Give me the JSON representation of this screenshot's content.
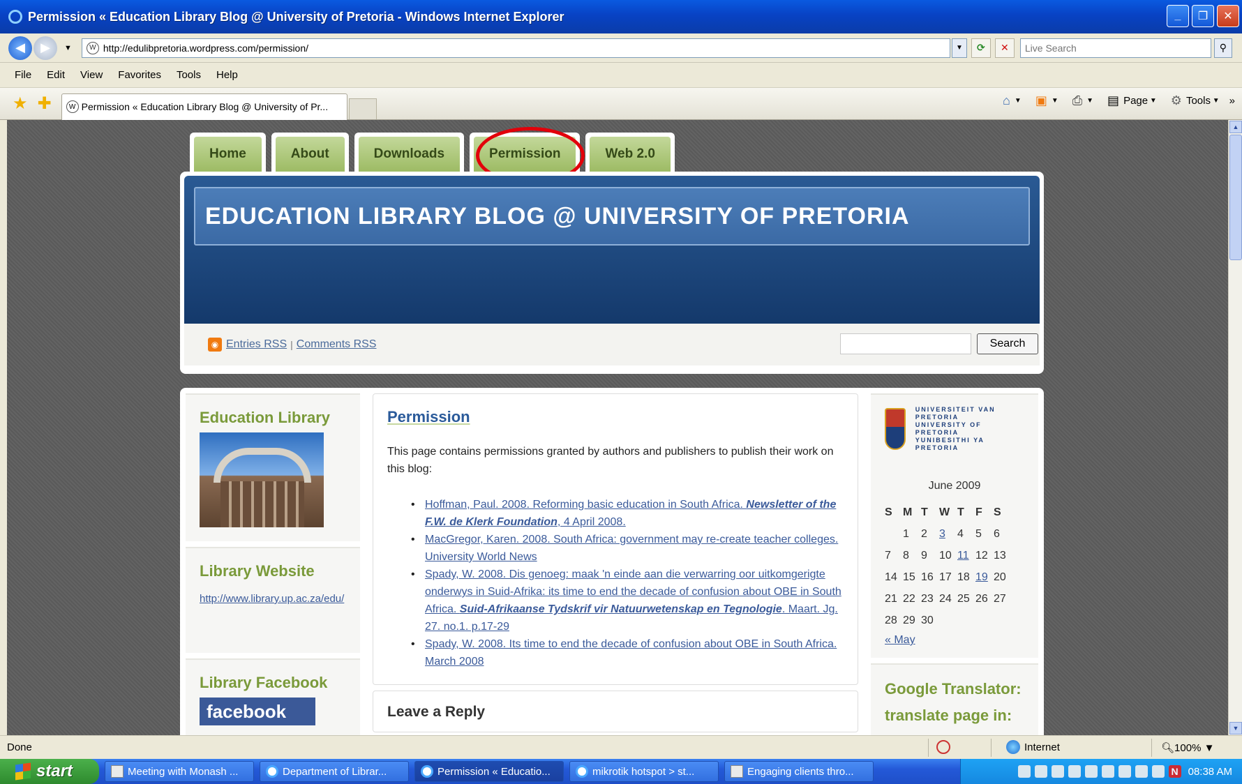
{
  "window": {
    "title": "Permission « Education Library Blog @ University of Pretoria - Windows Internet Explorer",
    "minimize": "_",
    "maximize": "❐",
    "close": "✕"
  },
  "address": {
    "url": "http://edulibpretoria.wordpress.com/permission/",
    "search_placeholder": "Live Search"
  },
  "menu": [
    "File",
    "Edit",
    "View",
    "Favorites",
    "Tools",
    "Help"
  ],
  "tab": {
    "title": "Permission « Education Library Blog @ University of Pr..."
  },
  "command_bar": {
    "page_label": "Page",
    "tools_label": "Tools",
    "more": "»"
  },
  "page": {
    "nav_tabs": [
      "Home",
      "About",
      "Downloads",
      "Permission",
      "Web 2.0"
    ],
    "blog_title": "EDUCATION LIBRARY BLOG @ UNIVERSITY OF PRETORIA",
    "rss": {
      "entries": "Entries RSS",
      "separator": "|",
      "comments": "Comments RSS"
    },
    "search_button": "Search",
    "left_sidebar": {
      "education_library_title": "Education Library",
      "library_website_title": "Library Website",
      "library_website_url": "http://www.library.up.ac.za/edu/",
      "library_facebook_title": "Library Facebook",
      "facebook_logo": "facebook"
    },
    "post": {
      "title": "Permission",
      "intro": "This page contains permissions granted by authors and publishers to publish their work on this blog:",
      "items": [
        {
          "pre": "Hoffman, Paul. 2008. Reforming basic education in South Africa. ",
          "em": "Newsletter of the F.W. de Klerk Foundation",
          "post": ", 4 April 2008."
        },
        {
          "pre": "MacGregor, Karen. 2008. South Africa: government may re-create teacher colleges. University World News",
          "em": "",
          "post": ""
        },
        {
          "pre": "Spady, W. 2008. Dis genoeg: maak 'n einde aan die verwarring oor uitkomgerigte onderwys in Suid-Afrika: its time to end the decade of confusion about OBE in South Africa. ",
          "em": "Suid-Afrikaanse Tydskrif vir Natuurwetenskap en Tegnologie",
          "post": ". Maart. Jg. 27. no.1. p.17-29"
        },
        {
          "pre": "Spady, W. 2008. Its time to end the decade of confusion about OBE in South Africa. March 2008",
          "em": "",
          "post": ""
        }
      ],
      "reply_title": "Leave a Reply"
    },
    "right_sidebar": {
      "university_name_lines": [
        "UNIVERSITEIT VAN PRETORIA",
        "UNIVERSITY OF PRETORIA",
        "YUNIBESITHI YA PRETORIA"
      ],
      "calendar": {
        "caption": "June 2009",
        "headers": [
          "S",
          "M",
          "T",
          "W",
          "T",
          "F",
          "S"
        ],
        "rows": [
          [
            "",
            "1",
            "2",
            "3",
            "4",
            "5",
            "6"
          ],
          [
            "7",
            "8",
            "9",
            "10",
            "11",
            "12",
            "13"
          ],
          [
            "14",
            "15",
            "16",
            "17",
            "18",
            "19",
            "20"
          ],
          [
            "21",
            "22",
            "23",
            "24",
            "25",
            "26",
            "27"
          ],
          [
            "28",
            "29",
            "30",
            "",
            "",
            "",
            ""
          ]
        ],
        "linked_days": [
          "3",
          "11",
          "19"
        ],
        "prev": "« May"
      },
      "translator_title": "Google Translator: translate page in:"
    }
  },
  "status": {
    "text": "Done",
    "zone": "Internet",
    "zoom": "100%"
  },
  "taskbar": {
    "start": "start",
    "tasks": [
      {
        "label": "Meeting with Monash ...",
        "icon": "document"
      },
      {
        "label": "Department of Librar...",
        "icon": "ie"
      },
      {
        "label": "Permission « Educatio...",
        "icon": "ie"
      },
      {
        "label": "mikrotik hotspot > st...",
        "icon": "ie"
      },
      {
        "label": "Engaging clients thro...",
        "icon": "document"
      }
    ],
    "clock": "08:38 AM",
    "tray_n": "N"
  },
  "colors": {
    "xp_blue": "#0a5ae0",
    "nav_green": "#9dbb64",
    "header_blue": "#14396b",
    "highlight_red": "#e2000a",
    "sidebar_green": "#7a9a3a",
    "link_blue": "#3a5a9a"
  }
}
